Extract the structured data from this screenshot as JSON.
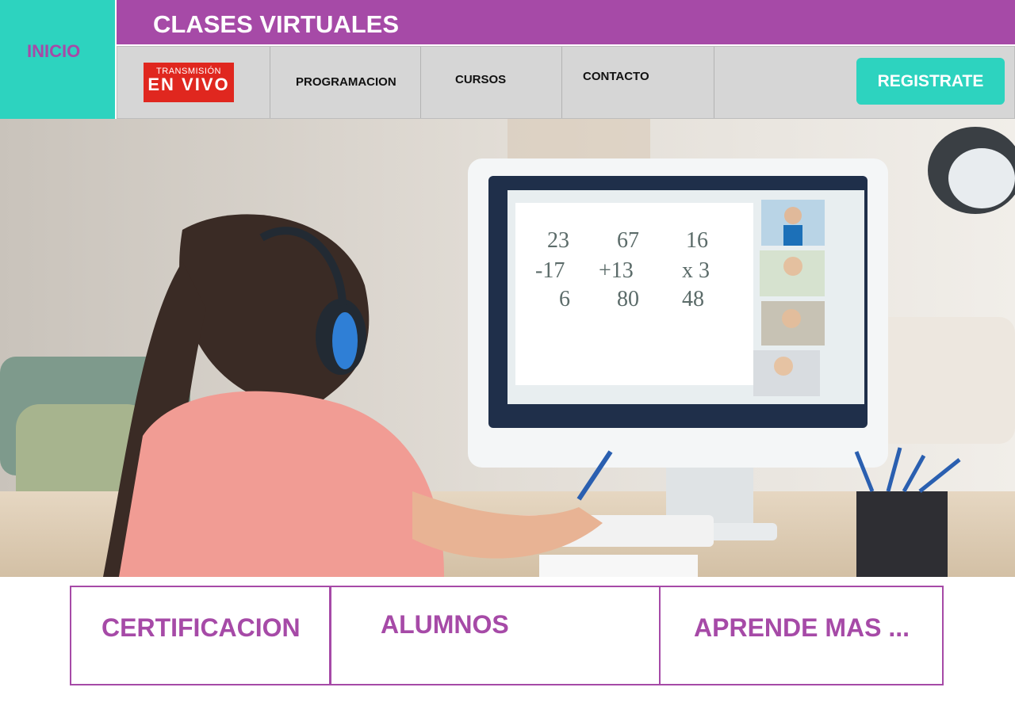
{
  "colors": {
    "accent_teal": "#2dd3bf",
    "accent_purple": "#a64aa7",
    "nav_gray": "#d6d6d6",
    "live_red": "#e0271f"
  },
  "sidebar": {
    "home_label": "INICIO"
  },
  "header": {
    "title": "CLASES VIRTUALES"
  },
  "nav": {
    "live_badge": {
      "top": "TRANSMISIÓN",
      "bottom": "EN VIVO"
    },
    "links": [
      "PROGRAMACION",
      "CURSOS",
      "CONTACTO"
    ],
    "register_label": "REGISTRATE"
  },
  "hero": {
    "alt_subject": "girl-in-online-class",
    "math": {
      "col1": [
        "23",
        "-17",
        "6"
      ],
      "col2": [
        "67",
        "+13",
        "80"
      ],
      "col3": [
        "16",
        "x 3",
        "48"
      ]
    }
  },
  "features": [
    "CERTIFICACION",
    "ALUMNOS",
    "APRENDE MAS ..."
  ]
}
